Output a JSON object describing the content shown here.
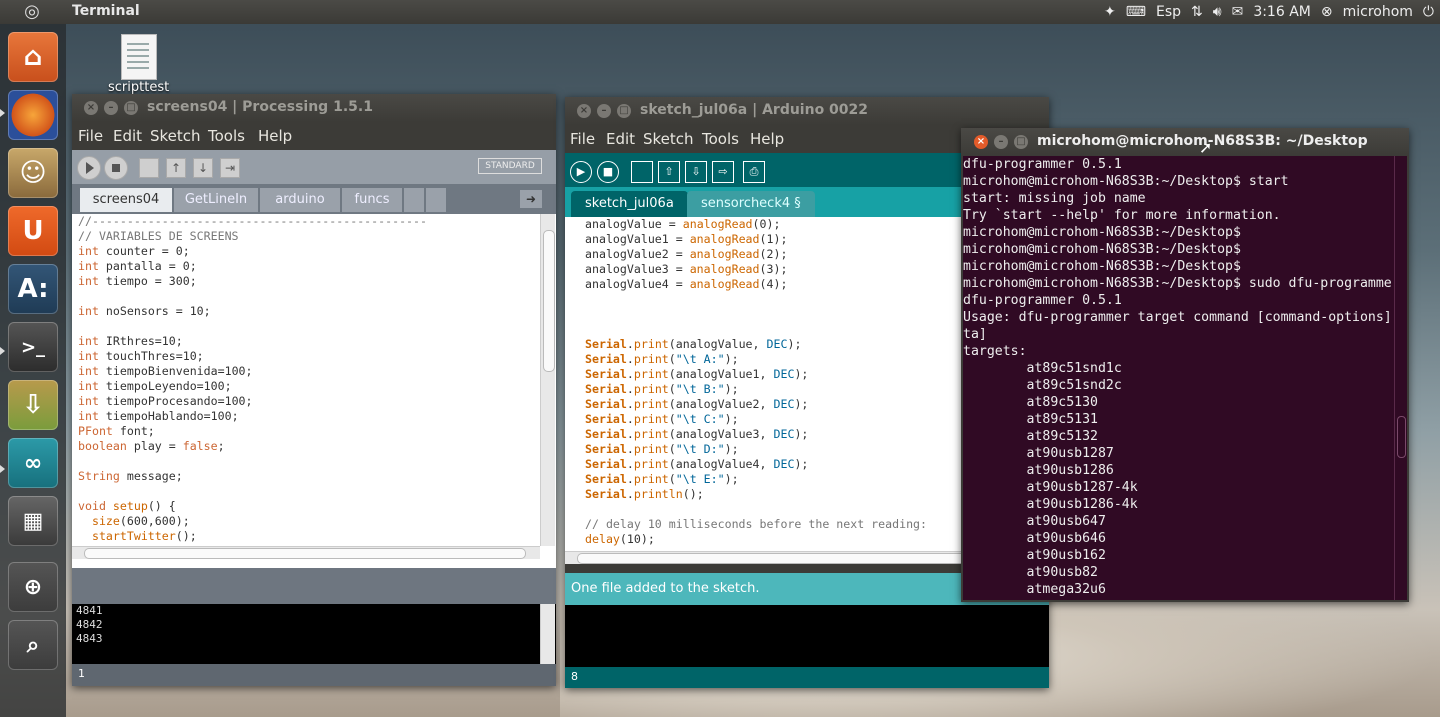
{
  "topbar": {
    "app_title": "Terminal",
    "keyboard_layout": "Esp",
    "time": "3:16 AM",
    "user": "microhom"
  },
  "launcher": {
    "items": [
      "Home Folder",
      "Firefox",
      "Ubuntu Software Center",
      "Ubuntu One",
      "Arduino A",
      "Terminal",
      "Archive Manager",
      "Arduino",
      "Workspace Switcher",
      "Dash Search",
      "Files Search"
    ]
  },
  "desktop": {
    "icon_label": "scripttest"
  },
  "processing": {
    "title": "screens04 | Processing 1.5.1",
    "menu": [
      "File",
      "Edit",
      "Sketch",
      "Tools",
      "Help"
    ],
    "mode_label": "STANDARD",
    "tabs": [
      "screens04",
      "GetLineIn",
      "arduino",
      "funcs"
    ],
    "code": [
      "//------------------------------------------------",
      "// VARIABLES DE SCREENS",
      "int counter = 0;",
      "int pantalla = 0;",
      "int tiempo = 300;",
      "",
      "int noSensors = 10;",
      "",
      "int IRthres=10;",
      "int touchThres=10;",
      "int tiempoBienvenida=100;",
      "int tiempoLeyendo=100;",
      "int tiempoProcesando=100;",
      "int tiempoHablando=100;",
      "PFont font;",
      "boolean play = false;",
      "",
      "String message;",
      "",
      "void setup() {",
      "  size(600,600);",
      "  startTwitter();"
    ],
    "console": [
      "4841",
      "4842",
      "4843"
    ],
    "line_number": "1"
  },
  "arduino": {
    "title": "sketch_jul06a | Arduino 0022",
    "menu": [
      "File",
      "Edit",
      "Sketch",
      "Tools",
      "Help"
    ],
    "tabs": [
      "sketch_jul06a",
      "sensorcheck4 §"
    ],
    "code": [
      "analogValue = analogRead(0);",
      "analogValue1 = analogRead(1);",
      "analogValue2 = analogRead(2);",
      "analogValue3 = analogRead(3);",
      "analogValue4 = analogRead(4);",
      "",
      "",
      "",
      "Serial.print(analogValue, DEC);",
      "Serial.print(\"\\t A:\");",
      "Serial.print(analogValue1, DEC);",
      "Serial.print(\"\\t B:\");",
      "Serial.print(analogValue2, DEC);",
      "Serial.print(\"\\t C:\");",
      "Serial.print(analogValue3, DEC);",
      "Serial.print(\"\\t D:\");",
      "Serial.print(analogValue4, DEC);",
      "Serial.print(\"\\t E:\");",
      "Serial.println();",
      "",
      "// delay 10 milliseconds before the next reading:",
      "delay(10);"
    ],
    "status": "One file added to the sketch.",
    "line_number": "8"
  },
  "terminal": {
    "title": "microhom@microhom-N68S3B: ~/Desktop",
    "lines": [
      "dfu-programmer 0.5.1",
      "microhom@microhom-N68S3B:~/Desktop$ start",
      "start: missing job name",
      "Try `start --help' for more information.",
      "microhom@microhom-N68S3B:~/Desktop$",
      "microhom@microhom-N68S3B:~/Desktop$",
      "microhom@microhom-N68S3B:~/Desktop$",
      "microhom@microhom-N68S3B:~/Desktop$ sudo dfu-programme",
      "dfu-programmer 0.5.1",
      "Usage: dfu-programmer target command [command-options]",
      "ta]",
      "targets:",
      "        at89c51snd1c",
      "        at89c51snd2c",
      "        at89c5130",
      "        at89c5131",
      "        at89c5132",
      "        at90usb1287",
      "        at90usb1286",
      "        at90usb1287-4k",
      "        at90usb1286-4k",
      "        at90usb647",
      "        at90usb646",
      "        at90usb162",
      "        at90usb82",
      "        atmega32u6"
    ]
  }
}
